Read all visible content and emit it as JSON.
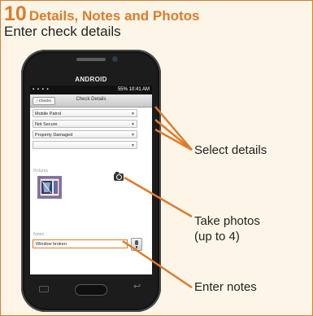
{
  "header": {
    "step_number": "10",
    "title": "Details, Notes and Photos",
    "subtitle": "Enter check details"
  },
  "phone": {
    "brand": "ANDROID",
    "status_time": "10:41 AM",
    "status_battery": "55%"
  },
  "app": {
    "back_label": "Checks",
    "title": "Check Details",
    "selects": [
      "Mobile Patrol",
      "Not Secure",
      "Property Damaged",
      ""
    ],
    "pictures_label": "Pictures",
    "notes_label": "Notes",
    "notes_value": "Window broken"
  },
  "annotations": {
    "select_details": "Select details",
    "take_photos_line1": "Take photos",
    "take_photos_line2": "(up to 4)",
    "enter_notes": "Enter notes"
  },
  "colors": {
    "accent": "#e07a2a",
    "phone_body": "#1c1c1c"
  },
  "icons": [
    "camera-icon",
    "microphone-icon",
    "chevron-down-icon",
    "back-icon",
    "home-icon",
    "menu-icon"
  ]
}
